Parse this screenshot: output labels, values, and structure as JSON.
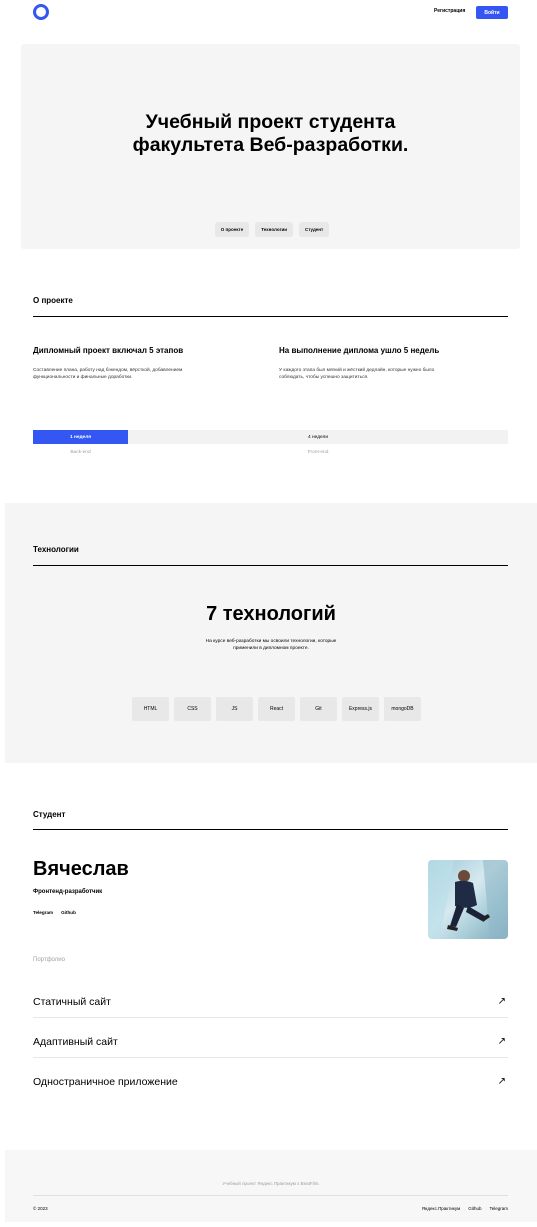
{
  "header": {
    "logo_icon": "logo-circle-icon",
    "register_label": "Регистрация",
    "login_label": "Войти",
    "accent": "#3456f3"
  },
  "promo": {
    "title_line1": "Учебный проект студента",
    "title_line2": "факультета Веб-разработки.",
    "nav": [
      "О проекте",
      "Технологии",
      "Студент"
    ]
  },
  "about": {
    "title": "О проекте",
    "col1_heading": "Дипломный проект включал 5 этапов",
    "col1_text_line1": "Составление плана, работу над бэкендом, вёрсткой, добавлением",
    "col1_text_line2": "функциональности и финальные доработки.",
    "col2_heading": "На выполнение диплома ушло 5 недель",
    "col2_text_line1": "У каждого этапа был мягкий и жёсткий дедлайн, которые нужно было",
    "col2_text_line2": "соблюдать, чтобы успешно защититься.",
    "bar_backend": "1 неделя",
    "bar_frontend": "4 недели",
    "cap_backend": "Back-end",
    "cap_frontend": "Front-end"
  },
  "tech": {
    "title": "Технологии",
    "heading": "7 технологий",
    "text_line1": "На курсе веб-разработки мы освоили технологии, которые",
    "text_line2": "применили в дипломном проекте.",
    "items": [
      "HTML",
      "CSS",
      "JS",
      "React",
      "Git",
      "Express.js",
      "mongoDB"
    ]
  },
  "student": {
    "title": "Студент",
    "name": "Вячеслав",
    "job": "Фронтенд-разработчик",
    "links": [
      "Telegram",
      "Github"
    ],
    "portfolio_caption": "Портфолио",
    "portfolio": [
      {
        "label": "Статичный сайт",
        "arrow": "↗"
      },
      {
        "label": "Адаптивный сайт",
        "arrow": "↗"
      },
      {
        "label": "Одностраничное приложение",
        "arrow": "↗"
      }
    ]
  },
  "footer": {
    "text": "Учебный проект Яндекс.Практикум х BeatFilm.",
    "copyright": "© 2023",
    "links": [
      "Яндекс.Практикум",
      "Github",
      "Telegram"
    ]
  }
}
